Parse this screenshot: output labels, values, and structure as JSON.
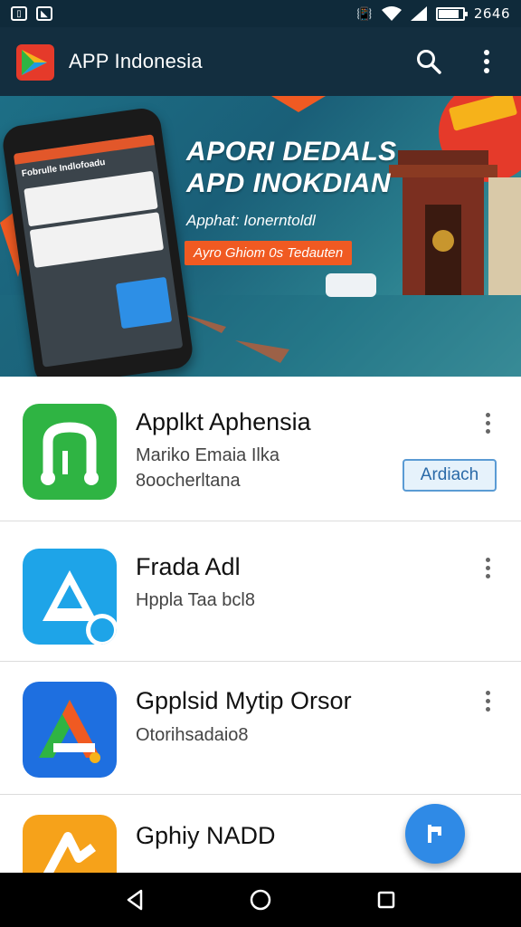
{
  "status_bar": {
    "time": "2646",
    "battery_level": 0.85,
    "left_icons": [
      "sim-card-icon",
      "image-icon"
    ],
    "right_icons": [
      "vibrate-icon",
      "wifi-icon",
      "signal-icon",
      "battery-icon"
    ]
  },
  "app_bar": {
    "title": "APP Indonesia",
    "accent": "#f05a22",
    "background": "#132e3f"
  },
  "banner": {
    "headline_1": "APORI DEDALS",
    "headline_2": "APD INOKDIAN",
    "subtitle": "Apphat: Ionerntoldl",
    "cta": "Ayro Ghiom 0s Tedauten",
    "phone_screen_title": "Fobrulle Indlofoadu"
  },
  "apps": [
    {
      "name": "Applkt Aphensia",
      "line1": "Mariko Emaia Ilka",
      "line2": "8oocherltana",
      "action": "Ardiach",
      "icon_color": "#2fb443"
    },
    {
      "name": "Frada Adl",
      "line1": "Hppla Taa bcl8",
      "line2": "",
      "action": "",
      "icon_color": "#1ea4e8"
    },
    {
      "name": "Gpplsid Mytip Orsor",
      "line1": "Otorihsadaio8",
      "line2": "",
      "action": "",
      "icon_color": "#1e6fe0"
    },
    {
      "name": "Gphiy NADD",
      "line1": "",
      "line2": "",
      "action": "",
      "icon_color": "#f6a21a"
    }
  ],
  "fab_icon": "flag-icon",
  "nav_bar": [
    "back-icon",
    "home-icon",
    "recents-icon"
  ]
}
